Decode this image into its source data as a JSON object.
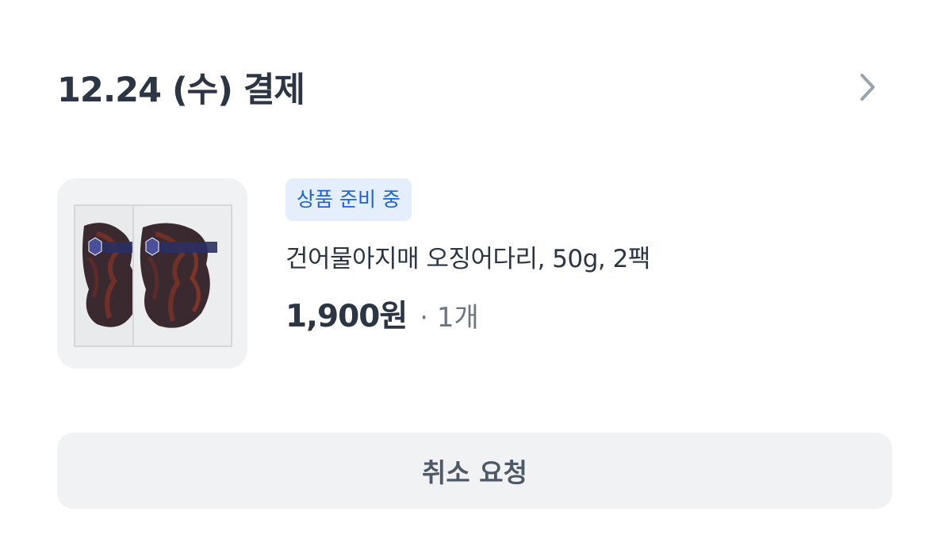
{
  "order": {
    "date_label": "12.24 (수) 결제"
  },
  "item": {
    "status": "상품 준비 중",
    "name": "건어물아지매 오징어다리, 50g, 2팩",
    "price": "1,900원",
    "quantity": "· 1개",
    "package_label": "건어물아지매"
  },
  "actions": {
    "cancel_label": "취소 요청"
  },
  "icons": {
    "header_arrow": "chevron-right-icon",
    "product_image": "product-thumbnail"
  },
  "colors": {
    "badge_bg": "#e4eefc",
    "badge_text": "#1a63d9",
    "title_text": "#2b3544",
    "muted_text": "#6b7684",
    "button_bg": "#f1f2f4"
  }
}
